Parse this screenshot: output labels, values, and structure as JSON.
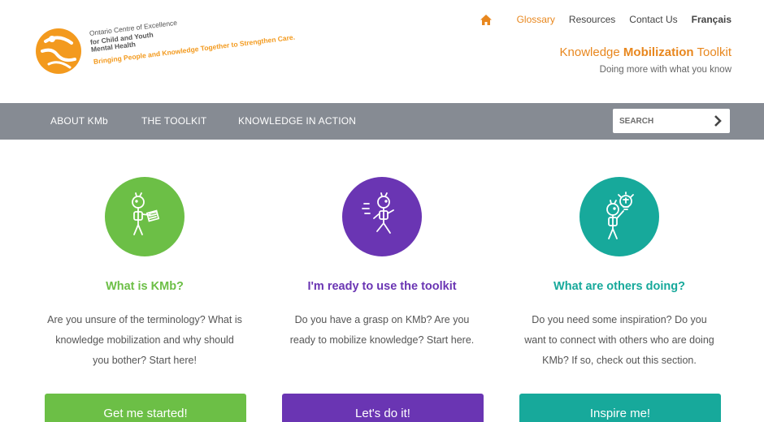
{
  "header": {
    "logo": {
      "line1": "Ontario Centre of Excellence",
      "line2": "for Child and Youth",
      "line3": "Mental Health",
      "tagline": "Bringing People and Knowledge Together to Strengthen Care."
    },
    "top_nav": {
      "home_icon": "home-icon",
      "items": [
        "Glossary",
        "Resources",
        "Contact Us",
        "Français"
      ],
      "active": "Glossary"
    },
    "toolkit_title": {
      "pre": "Knowledge ",
      "bold": "Mobilization",
      "post": " Toolkit"
    },
    "toolkit_subtitle": "Doing more with what you know"
  },
  "navbar": {
    "items": [
      "ABOUT KMb",
      "THE TOOLKIT",
      "KNOWLEDGE IN ACTION"
    ],
    "search": {
      "placeholder": "SEARCH",
      "icon": "chevron-right-icon"
    }
  },
  "columns": [
    {
      "heading": "What is KMb?",
      "body": "Are you unsure of the terminology? What is knowledge mobilization and why should you bother? Start here!",
      "button": "Get me started!",
      "color": "#6cbf46",
      "icon": "reading-figure-icon"
    },
    {
      "heading": "I'm ready to use the toolkit",
      "body": "Do you have a grasp on KMb? Are you ready to mobilize knowledge? Start here.",
      "button": "Let's do it!",
      "color": "#6a35b3",
      "icon": "running-figure-icon"
    },
    {
      "heading": "What are others doing?",
      "body": "Do you need some inspiration? Do you want to connect with others who are doing KMb? If so, check out this section.",
      "button": "Inspire me!",
      "color": "#17a99b",
      "icon": "lightbulb-figure-icon"
    }
  ],
  "colors": {
    "accent_orange": "#e8871e",
    "navbar_gray": "#868b93"
  }
}
